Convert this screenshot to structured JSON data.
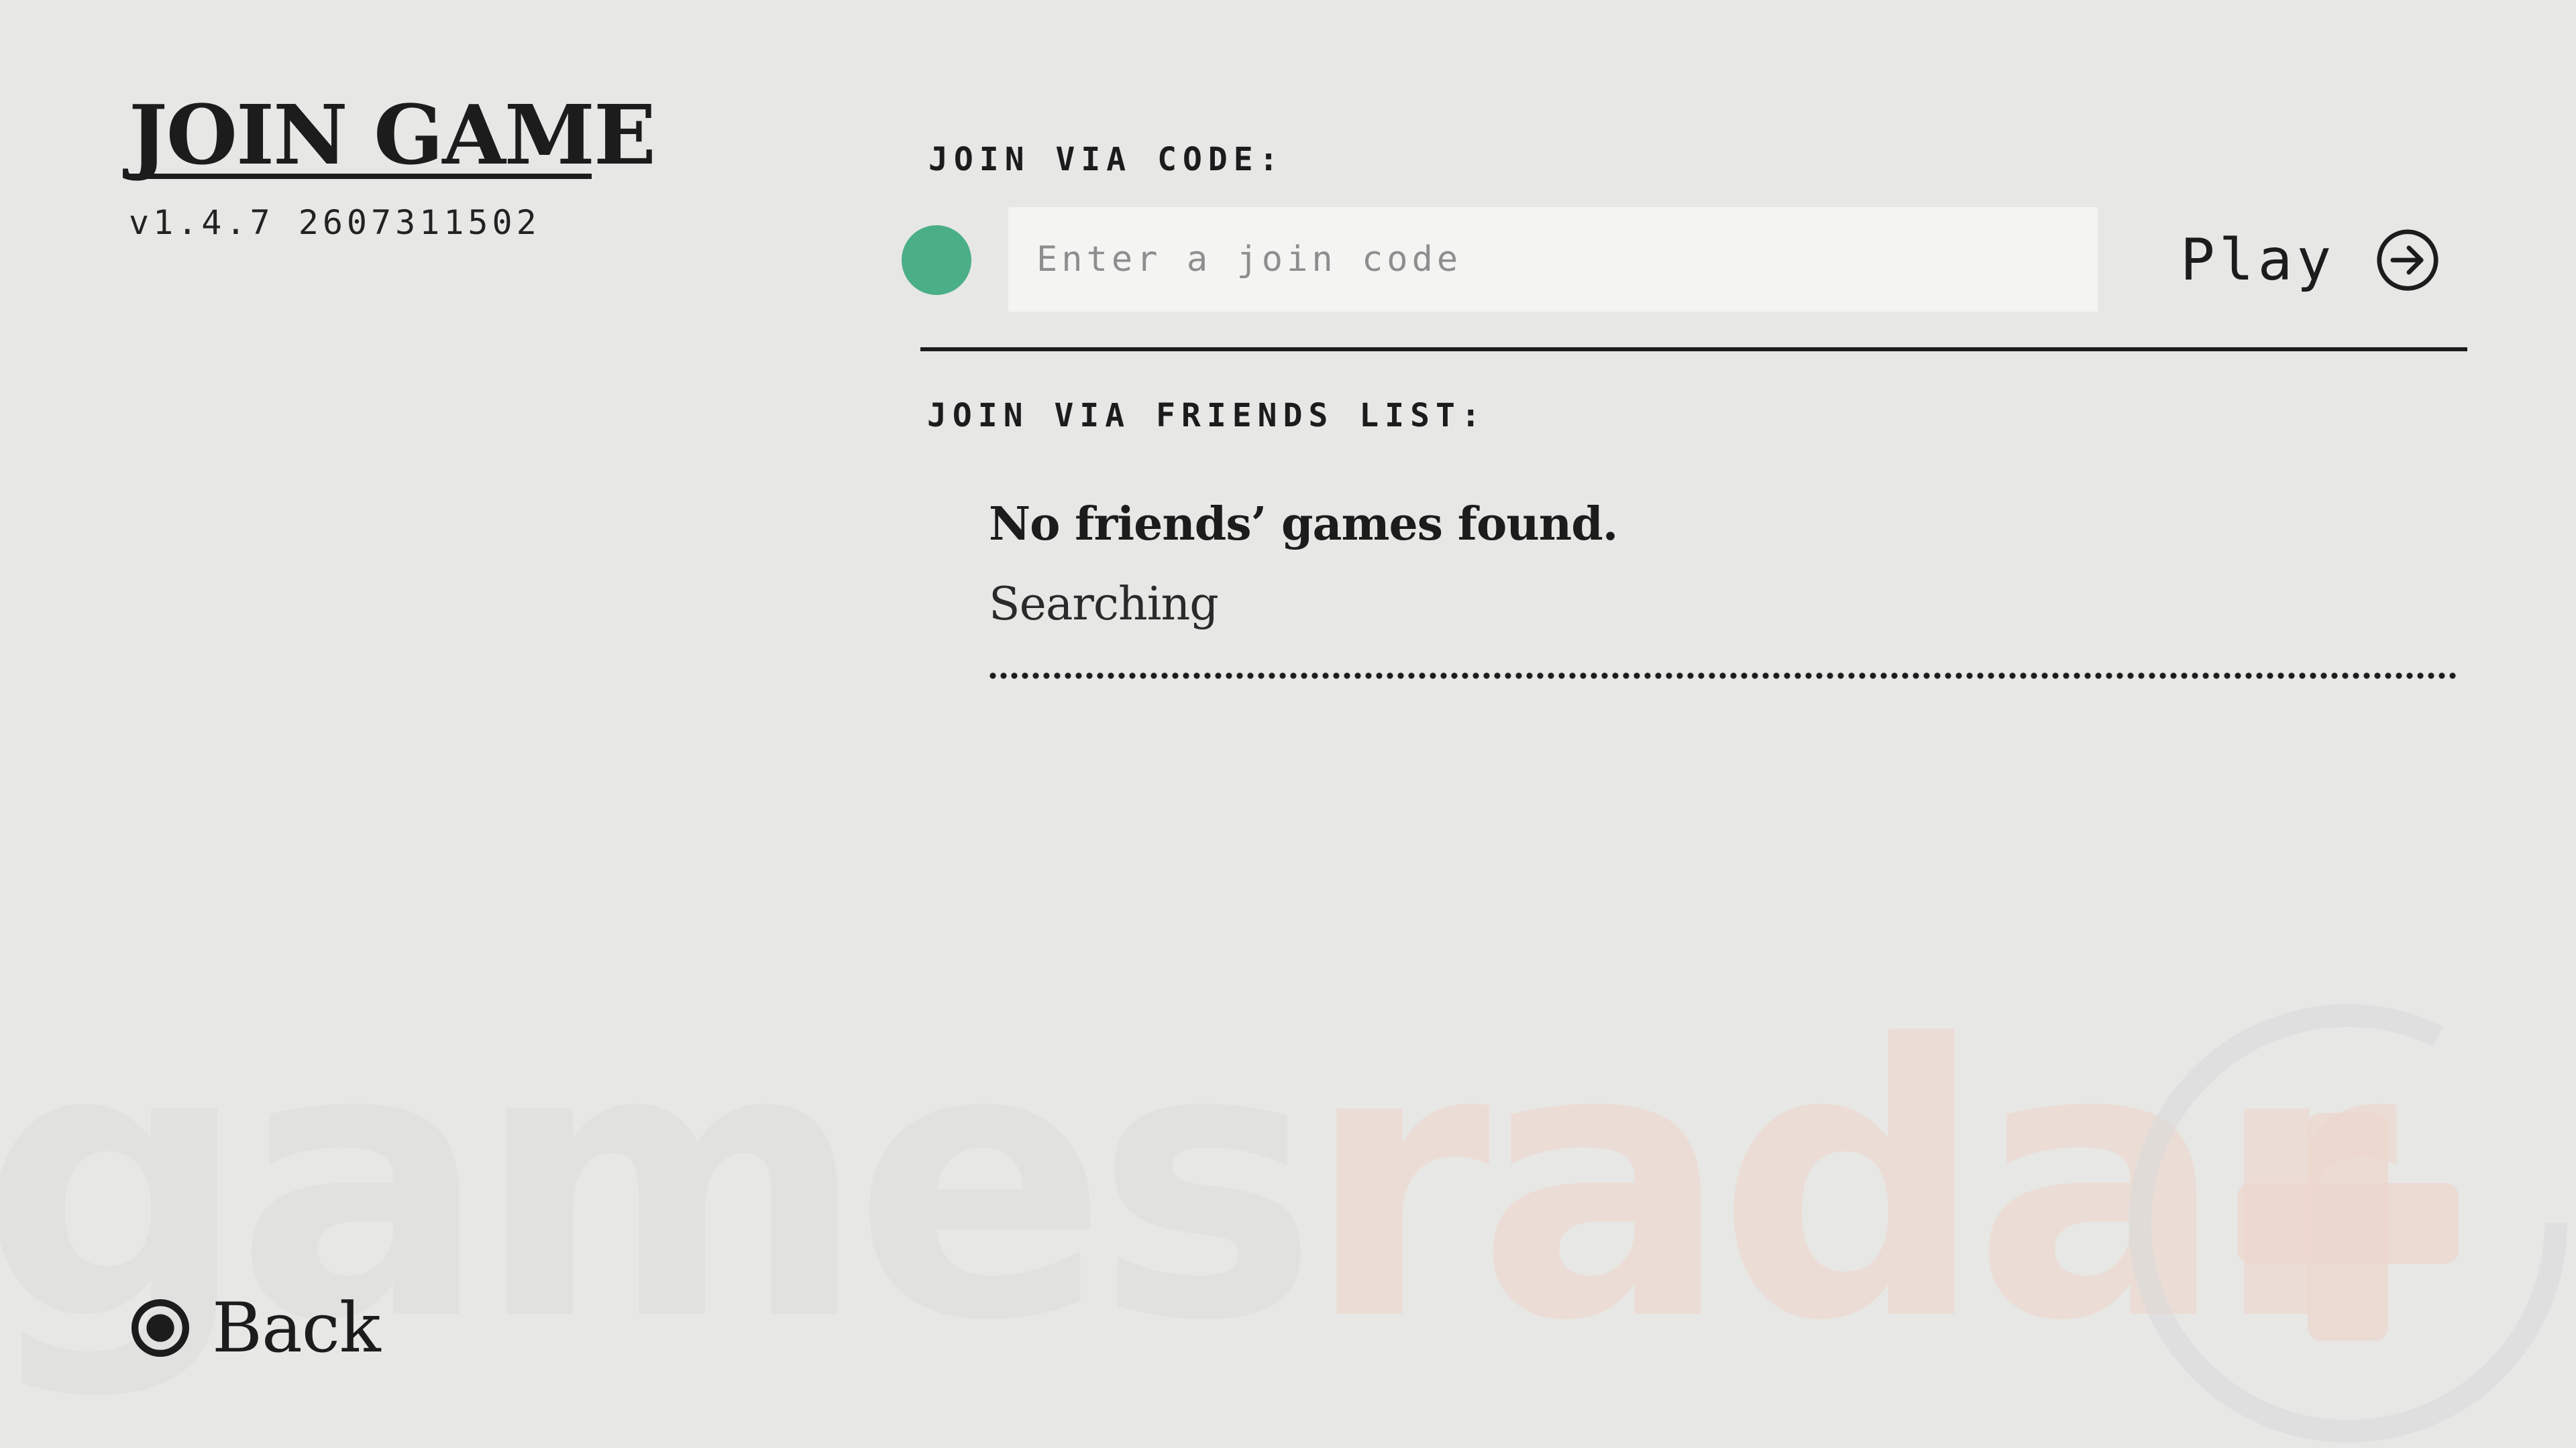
{
  "header": {
    "title": "JOIN GAME",
    "version": "v1.4.7 2607311502"
  },
  "join_code": {
    "label": "JOIN VIA CODE:",
    "input_value": "",
    "input_placeholder": "Enter a join code",
    "status_color": "#4aae86",
    "play_label": "Play",
    "play_icon": "arrow-right-circle-icon"
  },
  "friends": {
    "label": "JOIN VIA FRIENDS LIST:",
    "empty_message": "No friends’ games found.",
    "status": "Searching"
  },
  "footer": {
    "back_label": "Back",
    "back_icon": "circle-button-icon"
  },
  "watermark": {
    "part1": "games",
    "part2": "radar",
    "symbol": "+"
  },
  "colors": {
    "background": "#e7e7e5",
    "text": "#1c1c1c",
    "accent_green": "#4aae86",
    "input_bg": "#f4f4f3"
  }
}
